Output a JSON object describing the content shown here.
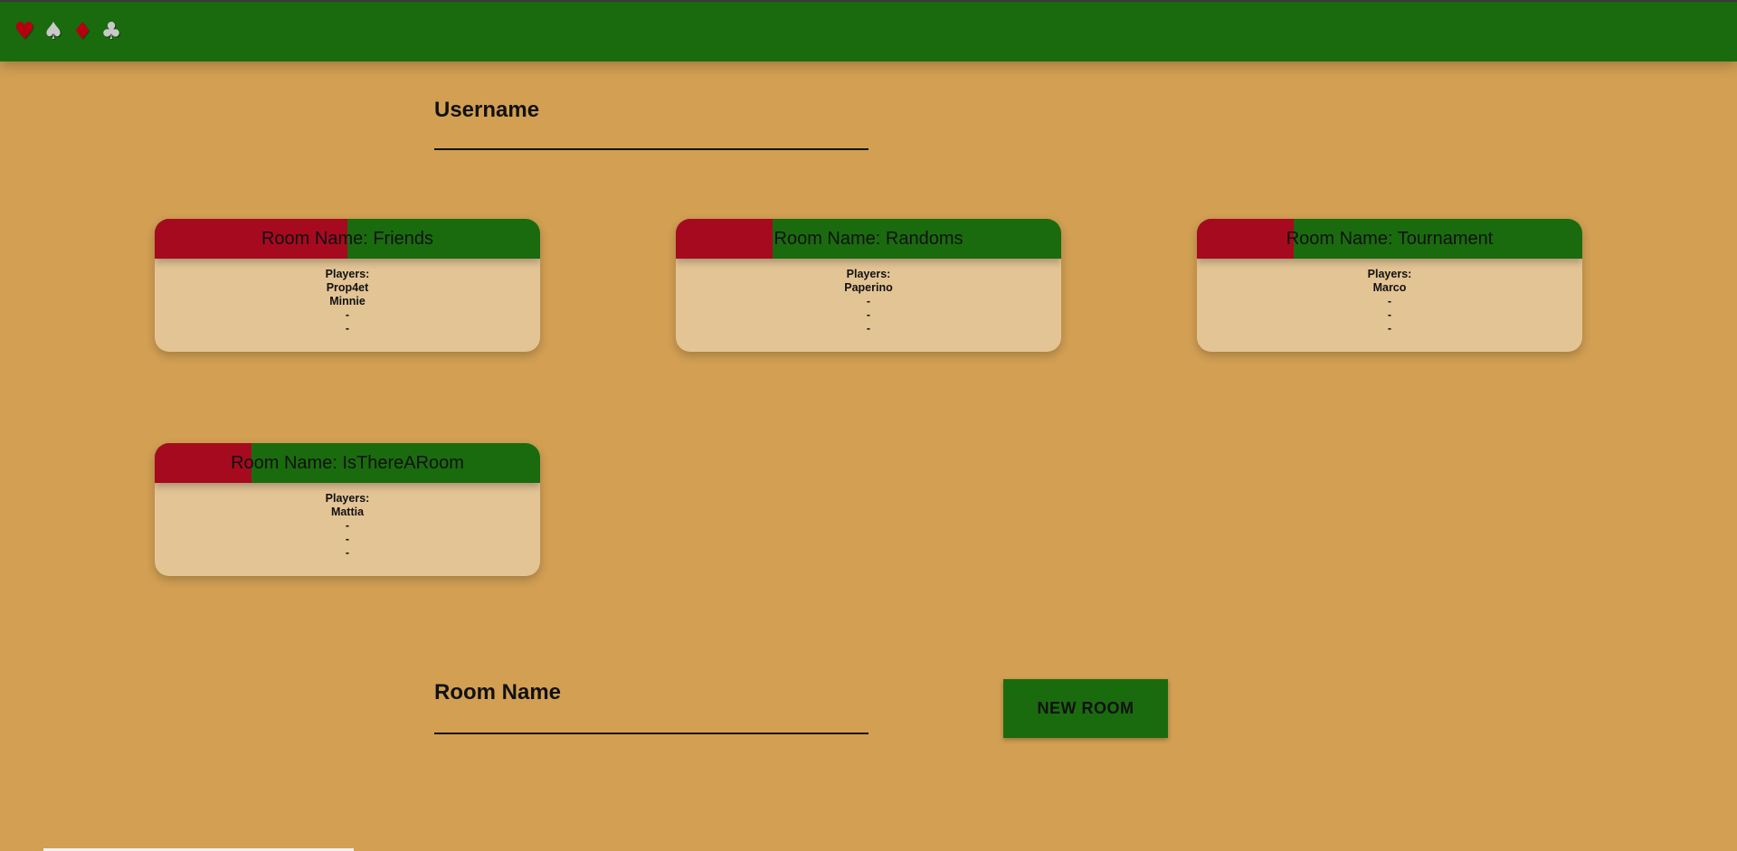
{
  "header": {
    "suits": [
      {
        "glyph": "♥",
        "name": "heart-icon",
        "color": "red"
      },
      {
        "glyph": "♠",
        "name": "spade-icon",
        "color": "grey"
      },
      {
        "glyph": "♦",
        "name": "diamond-icon",
        "color": "red"
      },
      {
        "glyph": "♣",
        "name": "club-icon",
        "color": "grey"
      }
    ]
  },
  "username": {
    "label": "Username",
    "value": ""
  },
  "rooms": [
    {
      "title": "Room Name: Friends",
      "fill_fraction": 0.5,
      "players_label": "Players:",
      "players": [
        "Prop4et",
        "Minnie",
        "-",
        "-"
      ]
    },
    {
      "title": "Room Name: Randoms",
      "fill_fraction": 0.25,
      "players_label": "Players:",
      "players": [
        "Paperino",
        "-",
        "-",
        "-"
      ]
    },
    {
      "title": "Room Name: Tournament",
      "fill_fraction": 0.25,
      "players_label": "Players:",
      "players": [
        "Marco",
        "-",
        "-",
        "-"
      ]
    },
    {
      "title": "Room Name: IsThereARoom",
      "fill_fraction": 0.25,
      "players_label": "Players:",
      "players": [
        "Mattia",
        "-",
        "-",
        "-"
      ]
    }
  ],
  "room_name": {
    "label": "Room Name",
    "value": ""
  },
  "new_room_button": {
    "label": "NEW ROOM"
  },
  "colors": {
    "background": "#d29f53",
    "header_green": "#1a6b0e",
    "fill_red": "#a60a1f",
    "card_body": "#e3c495"
  }
}
